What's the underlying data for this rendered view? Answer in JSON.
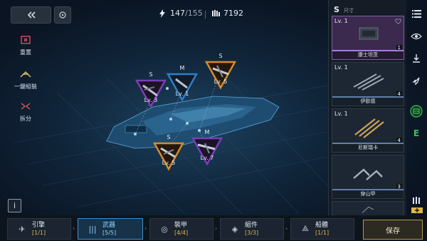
{
  "top": {
    "energy": "147",
    "energy_max": "/155",
    "currency": "7192"
  },
  "left_actions": [
    {
      "label": "重置",
      "icon": "reset-icon"
    },
    {
      "label": "一鍵組裝",
      "icon": "auto-assemble-icon"
    },
    {
      "label": "拆分",
      "icon": "split-icon"
    }
  ],
  "info_label": "i",
  "slots": [
    {
      "size": "S",
      "level": "Lv. 3",
      "color": "#7a3fb4"
    },
    {
      "size": "M",
      "level": "Lv. 1",
      "color": "#2f7fc8"
    },
    {
      "size": "S",
      "level": "Lv. 5",
      "color": "#d88a2a"
    },
    {
      "size": "S",
      "level": "Lv. 5",
      "color": "#d88a2a"
    },
    {
      "size": "M",
      "level": "Lv. 7",
      "color": "#7a3fb4"
    }
  ],
  "panel": {
    "size_label": "S",
    "size_caption": "尺寸",
    "items": [
      {
        "level": "Lv. 1",
        "count": "1",
        "name": "康士坦茨"
      },
      {
        "level": "Lv. 1",
        "count": "4",
        "name": "伊歐德"
      },
      {
        "level": "Lv. 1",
        "count": "4",
        "name": "尼斯瑞卡"
      },
      {
        "level": "",
        "count": "3",
        "name": "穿山甲"
      }
    ]
  },
  "side_icons": [
    "list-icon",
    "eye-icon",
    "download-icon",
    "rocket-icon",
    "storage-icon",
    "e-icon",
    "ammo-icon"
  ],
  "side_e_label": "E",
  "tabs": [
    {
      "label": "引擎",
      "value": "[1/1]",
      "icon": "engine-icon"
    },
    {
      "label": "武器",
      "value": "[5/5]",
      "icon": "weapon-icon"
    },
    {
      "label": "裝甲",
      "value": "[4/4]",
      "icon": "armor-icon"
    },
    {
      "label": "組件",
      "value": "[3/3]",
      "icon": "component-icon"
    },
    {
      "label": "船體",
      "value": "[1/1]",
      "icon": "hull-icon"
    }
  ],
  "save_label": "保存",
  "colors": {
    "accent": "#3f8fd0",
    "gold": "#e0b64a",
    "purple": "#7a3fb4",
    "orange": "#d88a2a",
    "blue": "#2f7fc8",
    "green": "#3dbf5f"
  }
}
